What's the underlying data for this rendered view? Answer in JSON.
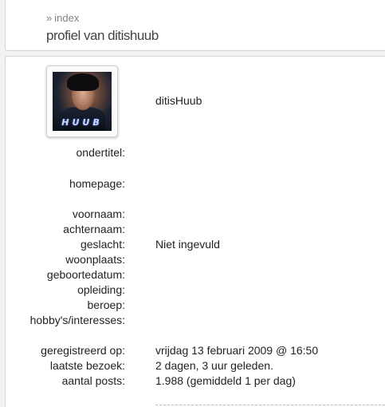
{
  "breadcrumb": {
    "arrow": "»",
    "label": "index"
  },
  "page_title": "profiel van ditishuub",
  "profile": {
    "avatar_tag": "HUUB",
    "username": "ditisHuub"
  },
  "fields": {
    "subtitle_label": "ondertitel:",
    "homepage_label": "homepage:",
    "firstname_label": "voornaam:",
    "lastname_label": "achternaam:",
    "gender_label": "geslacht:",
    "gender_value": "Niet ingevuld",
    "residence_label": "woonplaats:",
    "birthdate_label": "geboortedatum:",
    "education_label": "opleiding:",
    "occupation_label": "beroep:",
    "hobbies_label": "hobby's/interesses:",
    "registered_label": "geregistreerd op:",
    "registered_value": "vrijdag 13 februari 2009 @ 16:50",
    "lastvisit_label": "laatste bezoek:",
    "lastvisit_value": "2 dagen, 3 uur geleden.",
    "posts_label": "aantal posts:",
    "posts_value": "1.988 (gemiddeld 1 per dag)"
  }
}
